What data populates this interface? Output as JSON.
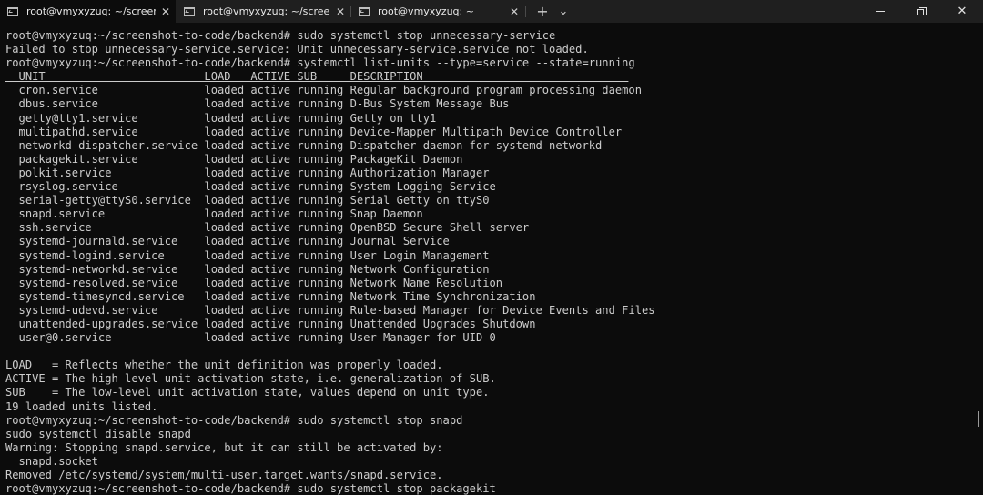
{
  "tabs": [
    {
      "title": "root@vmyxyzuq: ~/screenshot-to-code/backend",
      "close": "✕"
    },
    {
      "title": "root@vmyxyzuq: ~/screenshot-to-code/backend",
      "close": "✕"
    },
    {
      "title": "root@vmyxyzuq: ~",
      "close": "✕"
    }
  ],
  "toolbar": {
    "new_tab": "+",
    "dropdown": "⌄"
  },
  "window": {
    "minimize": "—",
    "maximize": "❐",
    "close": "✕"
  },
  "terminal": {
    "lines": [
      "root@vmyxyzuq:~/screenshot-to-code/backend# sudo systemctl stop unnecessary-service",
      "Failed to stop unnecessary-service.service: Unit unnecessary-service.service not loaded.",
      "root@vmyxyzuq:~/screenshot-to-code/backend# systemctl list-units --type=service --state=running",
      "  UNIT                        LOAD   ACTIVE SUB     DESCRIPTION                               ",
      "  cron.service                loaded active running Regular background program processing daemon",
      "  dbus.service                loaded active running D-Bus System Message Bus",
      "  getty@tty1.service          loaded active running Getty on tty1",
      "  multipathd.service          loaded active running Device-Mapper Multipath Device Controller",
      "  networkd-dispatcher.service loaded active running Dispatcher daemon for systemd-networkd",
      "  packagekit.service          loaded active running PackageKit Daemon",
      "  polkit.service              loaded active running Authorization Manager",
      "  rsyslog.service             loaded active running System Logging Service",
      "  serial-getty@ttyS0.service  loaded active running Serial Getty on ttyS0",
      "  snapd.service               loaded active running Snap Daemon",
      "  ssh.service                 loaded active running OpenBSD Secure Shell server",
      "  systemd-journald.service    loaded active running Journal Service",
      "  systemd-logind.service      loaded active running User Login Management",
      "  systemd-networkd.service    loaded active running Network Configuration",
      "  systemd-resolved.service    loaded active running Network Name Resolution",
      "  systemd-timesyncd.service   loaded active running Network Time Synchronization",
      "  systemd-udevd.service       loaded active running Rule-based Manager for Device Events and Files",
      "  unattended-upgrades.service loaded active running Unattended Upgrades Shutdown",
      "  user@0.service              loaded active running User Manager for UID 0",
      "",
      "LOAD   = Reflects whether the unit definition was properly loaded.",
      "ACTIVE = The high-level unit activation state, i.e. generalization of SUB.",
      "SUB    = The low-level unit activation state, values depend on unit type.",
      "19 loaded units listed.",
      "root@vmyxyzuq:~/screenshot-to-code/backend# sudo systemctl stop snapd",
      "sudo systemctl disable snapd",
      "Warning: Stopping snapd.service, but it can still be activated by:",
      "  snapd.socket",
      "Removed /etc/systemd/system/multi-user.target.wants/snapd.service.",
      "root@vmyxyzuq:~/screenshot-to-code/backend# sudo systemctl stop packagekit"
    ]
  },
  "colors": {
    "background": "#0c0c0c",
    "titlebar": "#1f1f1f",
    "text": "#cccccc"
  }
}
